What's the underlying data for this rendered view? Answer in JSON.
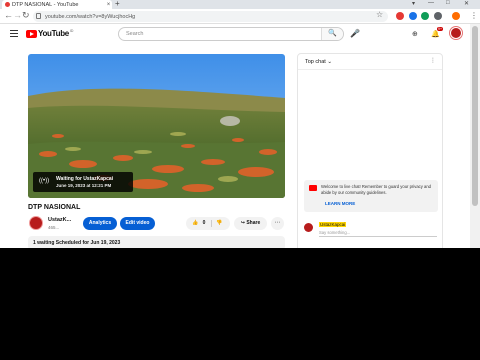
{
  "browser": {
    "tab_title": "DTP NASIONAL - YouTube",
    "tab_close": "×",
    "new_tab": "+",
    "url": "youtube.com/watch?v=8yWucjhocHg",
    "nav": {
      "back": "←",
      "forward": "→",
      "reload": "↻"
    },
    "menu_icon": "⋮",
    "star_icon": "☆",
    "window_controls": [
      "▾",
      "—",
      "□",
      "✕"
    ],
    "ext_colors": [
      "#e53935",
      "#1a73e8",
      "#0f9d58",
      "#5f6368",
      "#ff6d00"
    ]
  },
  "masthead": {
    "logo_word": "YouTube",
    "logo_country": "ID",
    "search_placeholder": "Search",
    "search_icon": "🔍",
    "mic_icon": "🎤",
    "create_icon": "⊕",
    "bell_icon": "🔔",
    "notification_count": "9+"
  },
  "player": {
    "waiting_title": "Waiting for UstazKapcai",
    "scheduled_time": "June 19, 2023 at 12:21 PM",
    "live_icon": "((•))"
  },
  "video": {
    "title": "DTP NASIONAL",
    "channel_name": "UstazK...",
    "channel_subs": "465...",
    "analytics_label": "Analytics",
    "edit_label": "Edit video",
    "like_icon": "👍",
    "like_count": "0",
    "dislike_icon": "👎",
    "share_icon": "↪",
    "share_label": "Share",
    "more_icon": "⋯",
    "description": "1 waiting  Scheduled for Jun 19, 2023"
  },
  "chat": {
    "header": "Top chat",
    "header_caret": "⌄",
    "menu_icon": "⋮",
    "welcome_text": "Welcome to live chat! Remember to guard your privacy and abide by our community guidelines.",
    "learn_more": "LEARN MORE",
    "user_name": "UstazKapcai",
    "input_placeholder": "Say something..."
  }
}
